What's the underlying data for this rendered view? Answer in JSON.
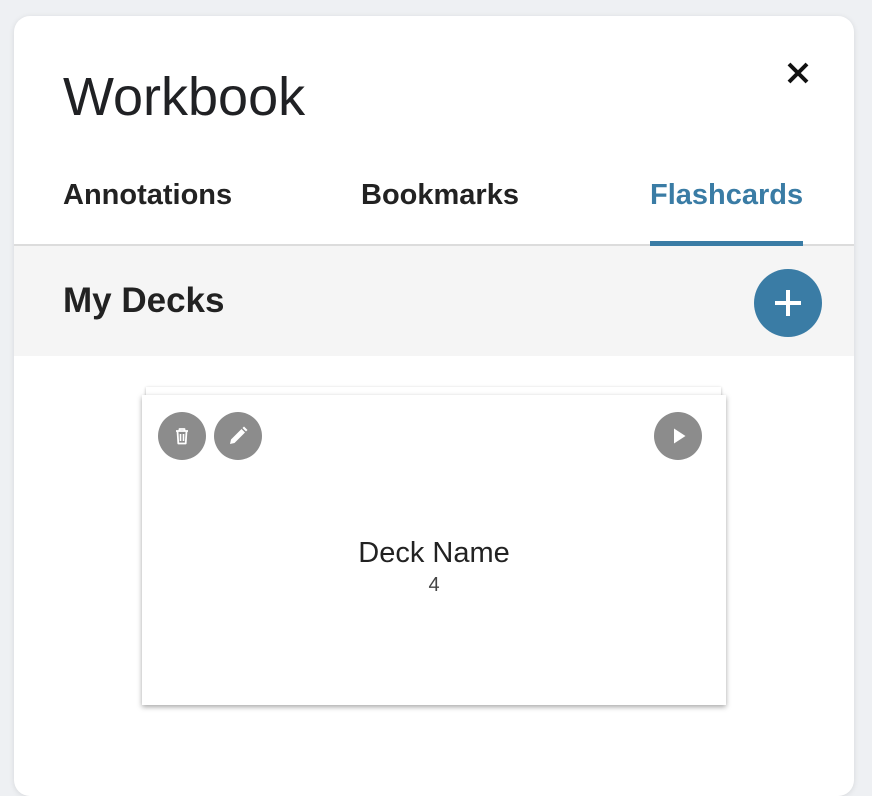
{
  "workbook": {
    "title": "Workbook"
  },
  "tabs": [
    {
      "label": "Annotations",
      "active": false
    },
    {
      "label": "Bookmarks",
      "active": false
    },
    {
      "label": "Flashcards",
      "active": true
    }
  ],
  "decks_section": {
    "title": "My Decks",
    "add_icon": "plus-icon"
  },
  "decks": [
    {
      "name": "Deck Name",
      "count": "4",
      "icons": [
        "trash-icon",
        "pencil-icon",
        "play-icon"
      ]
    }
  ],
  "colors": {
    "accent": "#3a7ca5",
    "icon_button": "#8c8c8c",
    "section_bg": "#f5f5f5"
  }
}
